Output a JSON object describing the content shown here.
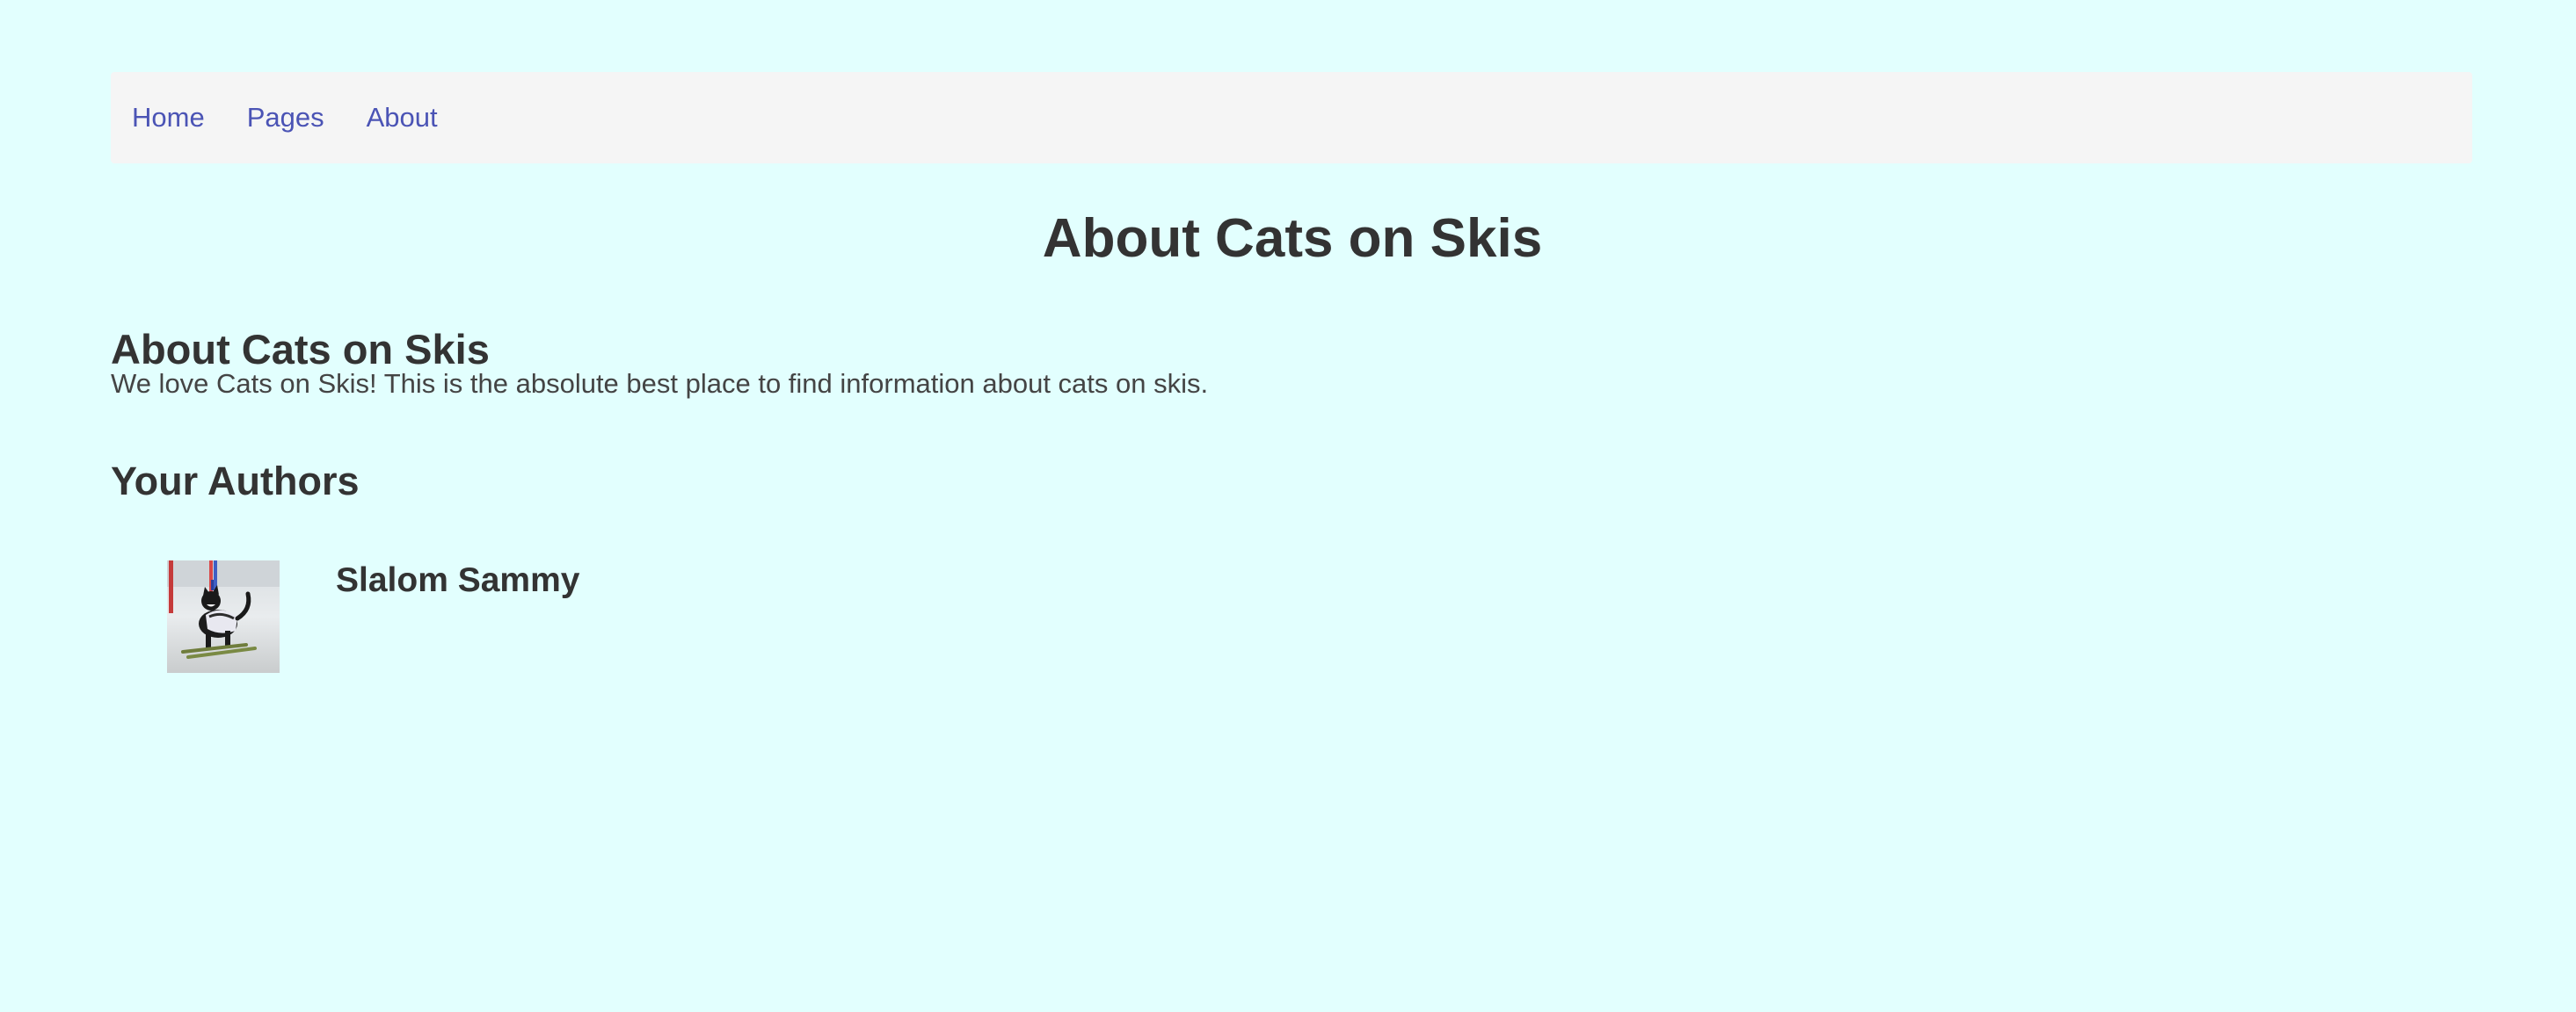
{
  "nav": {
    "items": [
      {
        "label": "Home"
      },
      {
        "label": "Pages"
      },
      {
        "label": "About"
      }
    ]
  },
  "page": {
    "title": "About Cats on Skis"
  },
  "about": {
    "heading": "About Cats on Skis",
    "text": "We love Cats on Skis! This is the absolute best place to find information about cats on skis."
  },
  "authors": {
    "heading": "Your Authors",
    "items": [
      {
        "name": "Slalom Sammy",
        "photo_icon": "cat-skiing-photo"
      }
    ]
  },
  "colors": {
    "background": "#e2fffe",
    "nav_background": "#f5f5f5",
    "link": "#4b54b5",
    "text": "#333333"
  }
}
